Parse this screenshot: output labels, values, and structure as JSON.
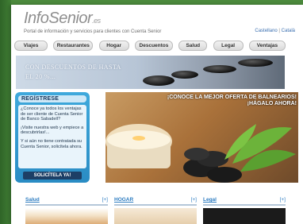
{
  "brand": {
    "info": "Info",
    "senior": "Senior",
    "tld": ".es"
  },
  "tagline": "Portal de información y servicios para clientes con Cuenta Senior",
  "languages": {
    "castellano": "Castellano",
    "separator": "|",
    "catala": "Català"
  },
  "nav": [
    "Viajes",
    "Restaurantes",
    "Hogar",
    "Descuentos",
    "Salud",
    "Legal",
    "Ventajas"
  ],
  "banner": {
    "line1": "CON DESCUENTOS DE HASTA",
    "line2": "EL 20 %..."
  },
  "promo": {
    "title": "REGÍSTRESE",
    "p1": "¿Conoce ya todos los ventajas de ser cliente de Cuenta Senior de Banco Sabadell?",
    "p2": "¡Visite nuestra web y empiece a descubrirlas!...",
    "p3": "Y si aún no tiene contratada su Cuenta Senior, solicítela ahora.",
    "button": "SOLICÍTELA YA!"
  },
  "spa": {
    "line1": "¡CONOCE LA MEJOR OFERTA DE BALNEARIOS!",
    "line2": "¡HÁGALO AHORA!"
  },
  "sections": [
    {
      "title": "Salud",
      "more": "[+]"
    },
    {
      "title": "HOGAR",
      "more": "[+]"
    },
    {
      "title": "Legal",
      "more": "[+]"
    }
  ]
}
